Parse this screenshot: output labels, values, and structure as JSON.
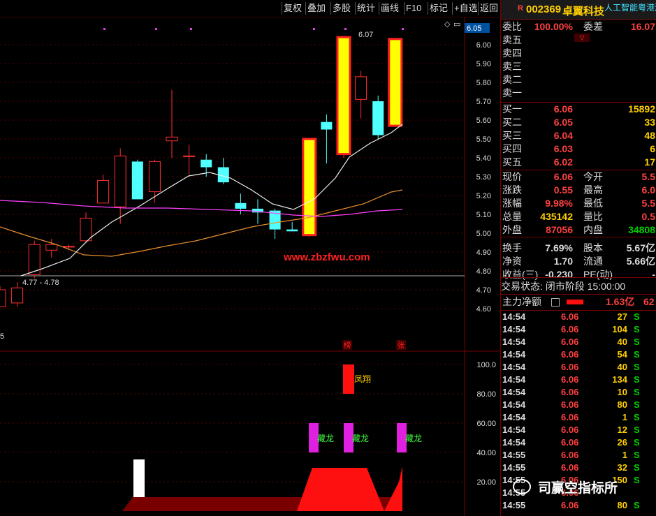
{
  "toolbar": {
    "items": [
      "复权",
      "叠加",
      "多股",
      "统计",
      "画线",
      "F10",
      "标记",
      "+自选",
      "返回"
    ]
  },
  "header": {
    "r_badge": "R",
    "code": "002369",
    "name": "卓翼科技",
    "tag": "人工智能粤港澳"
  },
  "chart": {
    "current_price_label": "6.05",
    "high_label": "6.07",
    "range_label": "4.77 - 4.78",
    "left_edge_label": "5",
    "y_ticks": [
      "6.00",
      "5.90",
      "5.80",
      "5.70",
      "5.60",
      "5.50",
      "5.40",
      "5.30",
      "5.20",
      "5.10",
      "5.00",
      "4.90",
      "4.80",
      "4.70",
      "4.60"
    ],
    "sub_ticks": [
      "100.0",
      "80.00",
      "60.00",
      "40.00",
      "20.00"
    ],
    "markers": [
      "榜",
      "张"
    ],
    "labels": {
      "fengxiang": "凤翔",
      "canglong": "藏龙"
    },
    "site_text": "www.zbzfwu.com"
  },
  "chart_data": {
    "type": "candlestick",
    "candles": [
      {
        "o": 4.61,
        "h": 4.72,
        "l": 4.61,
        "c": 4.7
      },
      {
        "o": 4.63,
        "h": 4.74,
        "l": 4.61,
        "c": 4.71
      },
      {
        "o": 4.78,
        "h": 4.96,
        "l": 4.76,
        "c": 4.94
      },
      {
        "o": 4.91,
        "h": 4.97,
        "l": 4.87,
        "c": 4.94
      },
      {
        "o": 4.93,
        "h": 4.94,
        "l": 4.91,
        "c": 4.93
      },
      {
        "o": 4.96,
        "h": 5.11,
        "l": 4.95,
        "c": 5.08
      },
      {
        "o": 5.16,
        "h": 5.31,
        "l": 5.16,
        "c": 5.28
      },
      {
        "o": 5.14,
        "h": 5.45,
        "l": 5.05,
        "c": 5.41
      },
      {
        "o": 5.38,
        "h": 5.39,
        "l": 5.18,
        "c": 5.18
      },
      {
        "o": 5.22,
        "h": 5.39,
        "l": 5.16,
        "c": 5.38
      },
      {
        "o": 5.49,
        "h": 5.76,
        "l": 5.4,
        "c": 5.51
      },
      {
        "o": 5.41,
        "h": 5.47,
        "l": 5.31,
        "c": 5.41
      },
      {
        "o": 5.39,
        "h": 5.42,
        "l": 5.3,
        "c": 5.35
      },
      {
        "o": 5.35,
        "h": 5.4,
        "l": 5.26,
        "c": 5.27
      },
      {
        "o": 5.16,
        "h": 5.21,
        "l": 5.1,
        "c": 5.13
      },
      {
        "o": 5.13,
        "h": 5.18,
        "l": 5.05,
        "c": 5.11
      },
      {
        "o": 5.12,
        "h": 5.13,
        "l": 4.97,
        "c": 5.02
      },
      {
        "o": 5.02,
        "h": 5.06,
        "l": 5.01,
        "c": 5.01
      },
      {
        "o": 4.99,
        "h": 5.5,
        "l": 4.98,
        "c": 5.5
      },
      {
        "o": 5.59,
        "h": 5.63,
        "l": 5.37,
        "c": 5.55
      },
      {
        "o": 5.42,
        "h": 6.04,
        "l": 5.4,
        "c": 6.04
      },
      {
        "o": 5.71,
        "h": 5.86,
        "l": 5.61,
        "c": 5.83
      },
      {
        "o": 5.7,
        "h": 5.73,
        "l": 5.5,
        "c": 5.52
      },
      {
        "o": 5.57,
        "h": 6.03,
        "l": 5.57,
        "c": 6.03
      }
    ]
  },
  "quote": {
    "webi_label": "委比",
    "webi_value": "100.00%",
    "wecha_label": "委差",
    "wecha_value": "16.07",
    "asks": [
      "卖五",
      "卖四",
      "卖三",
      "卖二",
      "卖一"
    ],
    "bids": [
      {
        "label": "买一",
        "price": "6.06",
        "vol": "15892"
      },
      {
        "label": "买二",
        "price": "6.05",
        "vol": "33"
      },
      {
        "label": "买三",
        "price": "6.04",
        "vol": "48"
      },
      {
        "label": "买四",
        "price": "6.03",
        "vol": "6"
      },
      {
        "label": "买五",
        "price": "6.02",
        "vol": "17"
      }
    ],
    "stats": [
      {
        "l1": "现价",
        "v1": "6.06",
        "l2": "今开",
        "v2": "5.5"
      },
      {
        "l1": "涨跌",
        "v1": "0.55",
        "l2": "最高",
        "v2": "6.0"
      },
      {
        "l1": "涨幅",
        "v1": "9.98%",
        "l2": "最低",
        "v2": "5.5"
      },
      {
        "l1": "总量",
        "v1": "435142",
        "l2": "量比",
        "v2": "0.5"
      },
      {
        "l1": "外盘",
        "v1": "87056",
        "l2": "内盘",
        "v2": "34808"
      },
      {
        "l1": "换手",
        "v1": "7.69%",
        "l2": "股本",
        "v2": "5.67亿"
      },
      {
        "l1": "净资",
        "v1": "1.70",
        "l2": "流通",
        "v2": "5.66亿"
      },
      {
        "l1": "收益(三)",
        "v1": "-0.230",
        "l2": "PE(动)",
        "v2": "-"
      }
    ],
    "trade_status": "交易状态: 闭市阶段 15:00:00",
    "main_label": "主力净额",
    "main_value": "1.63亿",
    "main_extra": "62",
    "ticks": [
      {
        "t": "14:54",
        "p": "6.06",
        "v": "27",
        "s": "S"
      },
      {
        "t": "14:54",
        "p": "6.06",
        "v": "104",
        "s": "S"
      },
      {
        "t": "14:54",
        "p": "6.06",
        "v": "40",
        "s": "S"
      },
      {
        "t": "14:54",
        "p": "6.06",
        "v": "54",
        "s": "S"
      },
      {
        "t": "14:54",
        "p": "6.06",
        "v": "40",
        "s": "S"
      },
      {
        "t": "14:54",
        "p": "6.06",
        "v": "134",
        "s": "S"
      },
      {
        "t": "14:54",
        "p": "6.06",
        "v": "10",
        "s": "S"
      },
      {
        "t": "14:54",
        "p": "6.06",
        "v": "80",
        "s": "S"
      },
      {
        "t": "14:54",
        "p": "6.06",
        "v": "1",
        "s": "S"
      },
      {
        "t": "14:54",
        "p": "6.06",
        "v": "12",
        "s": "S"
      },
      {
        "t": "14:54",
        "p": "6.06",
        "v": "26",
        "s": "S"
      },
      {
        "t": "14:55",
        "p": "6.06",
        "v": "1",
        "s": "S"
      },
      {
        "t": "14:55",
        "p": "6.06",
        "v": "32",
        "s": "S"
      },
      {
        "t": "14:55",
        "p": "6.06",
        "v": "150",
        "s": "S"
      },
      {
        "t": "14:55",
        "p": "6.06",
        "v": "",
        "s": ""
      },
      {
        "t": "14:55",
        "p": "6.06",
        "v": "80",
        "s": "S"
      }
    ]
  },
  "watermark": "司赢空指标所"
}
